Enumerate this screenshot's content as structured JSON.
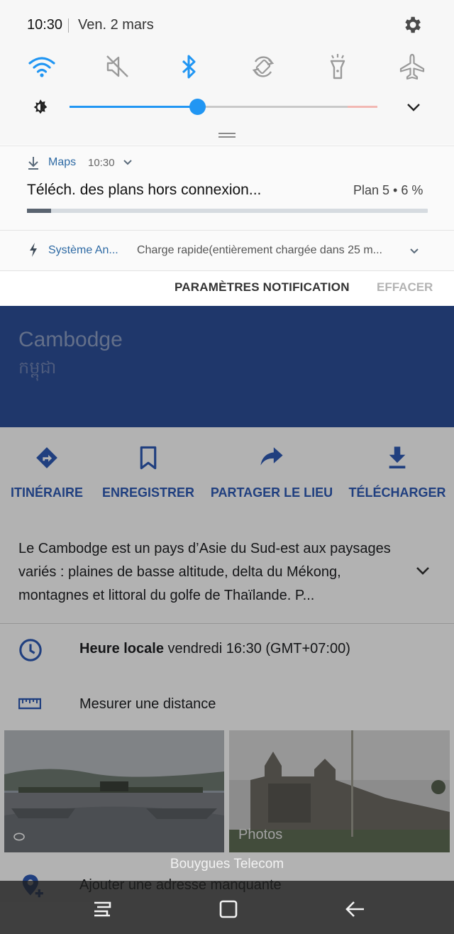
{
  "status": {
    "time": "10:30",
    "date": "Ven. 2 mars"
  },
  "quick_settings": {
    "tiles": [
      {
        "name": "wifi",
        "active": true
      },
      {
        "name": "sound-muted",
        "active": false
      },
      {
        "name": "bluetooth",
        "active": true
      },
      {
        "name": "auto-rotate",
        "active": false
      },
      {
        "name": "flashlight",
        "active": false
      },
      {
        "name": "airplane-mode",
        "active": false
      }
    ],
    "brightness_level": 0.42
  },
  "notifications": {
    "maps": {
      "app": "Maps",
      "time": "10:30",
      "title": "Téléch. des plans hors connexion...",
      "progress_label": "Plan 5 • 6 %",
      "progress": 0.06
    },
    "system": {
      "app": "Système An...",
      "text": "Charge rapide(entièrement chargée dans 25 m..."
    },
    "footer": {
      "settings_label": "PARAMÈTRES NOTIFICATION",
      "clear_label": "EFFACER"
    }
  },
  "place": {
    "title": "Cambodge",
    "subtitle": "កម្ពុជា",
    "actions": [
      {
        "label": "ITINÉRAIRE",
        "icon": "directions-icon"
      },
      {
        "label": "ENREGISTRER",
        "icon": "bookmark-icon"
      },
      {
        "label": "PARTAGER LE LIEU",
        "icon": "share-icon"
      },
      {
        "label": "TÉLÉCHARGER",
        "icon": "download-icon"
      }
    ],
    "description": "Le Cambodge est un pays d’Asie du Sud-est aux paysages variés : plaines de basse altitude, delta du Mékong, montagnes et littoral du golfe de Thaïlande. P...",
    "local_time_label": "Heure locale",
    "local_time_value": "vendredi 16:30 (GMT+07:00)",
    "measure_label": "Mesurer une distance",
    "photos_label": "Photos",
    "add_address_label": "Ajouter une adresse manquante"
  },
  "carrier": "Bouygues Telecom",
  "colors": {
    "accent": "#2196f3",
    "header_blue": "#2d4f9a",
    "action_blue": "#2f5bb7"
  }
}
